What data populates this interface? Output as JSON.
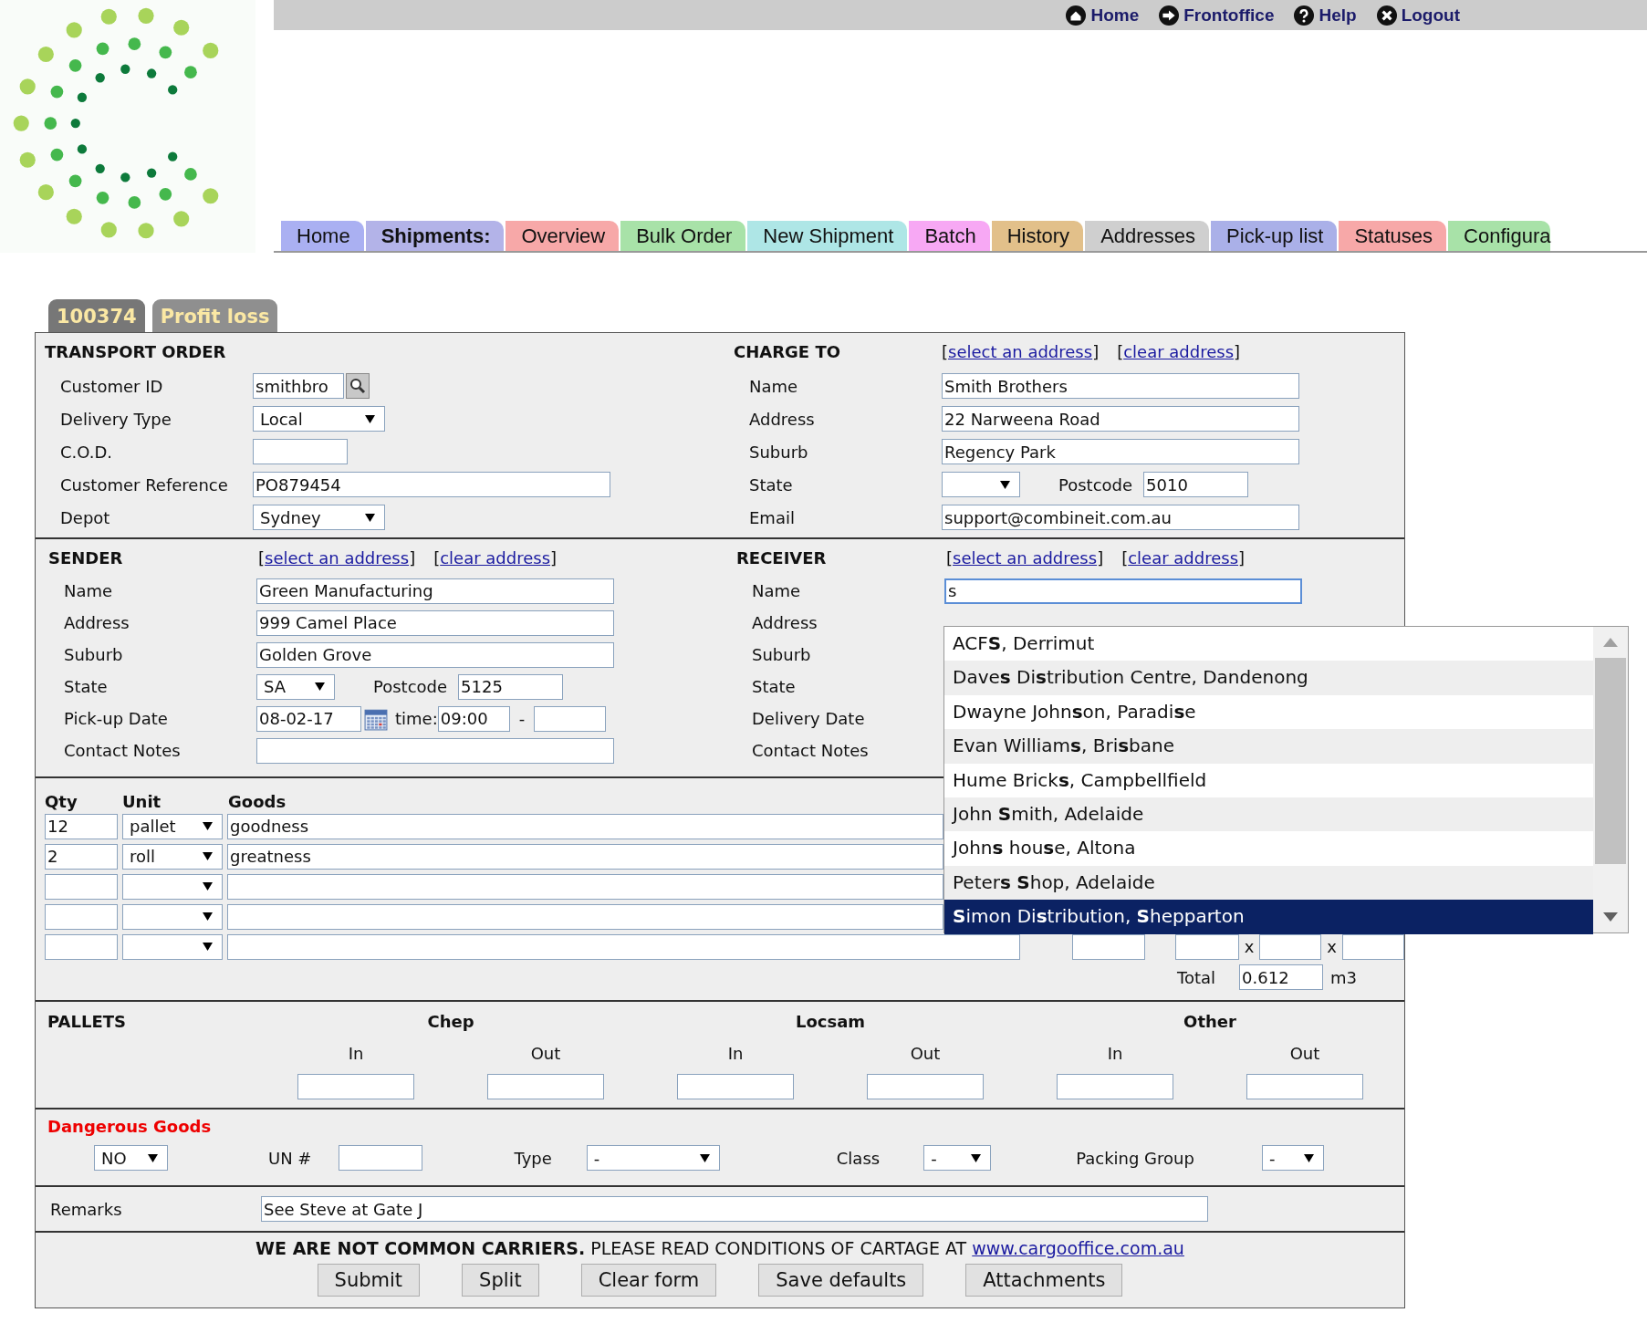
{
  "top_links": [
    {
      "label": "Home"
    },
    {
      "label": "Frontoffice"
    },
    {
      "label": "Help"
    },
    {
      "label": "Logout"
    }
  ],
  "nav_tabs": [
    {
      "label": "Home",
      "kind": "link",
      "color": "#aab0f2"
    },
    {
      "label": "Shipments:",
      "kind": "heading",
      "color": "#b3b3e8"
    },
    {
      "label": "Overview",
      "kind": "link",
      "color": "#f7a8a8"
    },
    {
      "label": "Bulk Order",
      "kind": "link",
      "color": "#a8e2a8"
    },
    {
      "label": "New Shipment",
      "kind": "link",
      "color": "#aee6e6"
    },
    {
      "label": "Batch",
      "kind": "link",
      "color": "#f7a8f4"
    },
    {
      "label": "History",
      "kind": "link",
      "color": "#e2c08a"
    },
    {
      "label": "Addresses",
      "kind": "link",
      "color": "#cfcfcf"
    },
    {
      "label": "Pick-up list",
      "kind": "link",
      "color": "#aab0e8"
    },
    {
      "label": "Statuses",
      "kind": "link",
      "color": "#f7a8a8"
    },
    {
      "label": "Configura",
      "kind": "link",
      "color": "#a8e2a8"
    }
  ],
  "form_tabs": [
    {
      "label": "100374",
      "selected": true
    },
    {
      "label": "Profit loss",
      "selected": false
    }
  ],
  "transport_order": {
    "heading": "TRANSPORT ORDER",
    "fields": [
      {
        "label": "Customer ID",
        "kind": "lookup",
        "value": "smithbro"
      },
      {
        "label": "Delivery Type",
        "kind": "select",
        "value": "Local"
      },
      {
        "label": "C.O.D.",
        "kind": "short"
      },
      {
        "label": "Customer Reference",
        "kind": "long",
        "value": "PO879454"
      },
      {
        "label": "Depot",
        "kind": "select",
        "value": "Sydney"
      }
    ]
  },
  "charge_to": {
    "heading": "CHARGE TO",
    "links": [
      {
        "before": "[",
        "label": "select an address",
        "after": "]"
      },
      {
        "before": "[",
        "label": "clear address",
        "after": "]"
      }
    ],
    "fields": [
      {
        "label": "Name",
        "kind": "long",
        "value": "Smith Brothers"
      },
      {
        "label": "Address",
        "kind": "long",
        "value": "22 Narweena Road"
      },
      {
        "label": "Suburb",
        "kind": "long",
        "value": "Regency Park"
      },
      {
        "label": "State",
        "kind": "state",
        "postcode_label": "Postcode",
        "postcode": "5010"
      },
      {
        "label": "Email",
        "kind": "long",
        "value": "support@combineit.com.au"
      }
    ]
  },
  "sender": {
    "heading": "SENDER",
    "links": [
      {
        "before": "[",
        "label": "select an address",
        "after": "]"
      },
      {
        "before": "[",
        "label": "clear address",
        "after": "]"
      }
    ],
    "fields": [
      {
        "label": "Name",
        "kind": "long",
        "value": "Green Manufacturing"
      },
      {
        "label": "Address",
        "kind": "long",
        "value": "999 Camel Place"
      },
      {
        "label": "Suburb",
        "kind": "long",
        "value": "Golden Grove"
      },
      {
        "label": "State",
        "kind": "state",
        "value": "SA",
        "postcode_label": "Postcode",
        "postcode": "5125"
      },
      {
        "label": "Pick-up Date",
        "kind": "date_time",
        "value": "08-02-17",
        "time_label": "time:",
        "time": "09:00",
        "dash": "-"
      },
      {
        "label": "Contact Notes",
        "kind": "long"
      }
    ]
  },
  "receiver": {
    "heading": "RECEIVER",
    "links": [
      {
        "before": "[",
        "label": "select an address",
        "after": "]"
      },
      {
        "before": "[",
        "label": "clear address",
        "after": "]"
      }
    ],
    "fields": [
      {
        "label": "Name",
        "kind": "long",
        "value": "s",
        "focused": true
      },
      {
        "label": "Address",
        "kind": "covered"
      },
      {
        "label": "Suburb",
        "kind": "covered"
      },
      {
        "label": "State",
        "kind": "covered"
      },
      {
        "label": "Delivery Date",
        "kind": "covered"
      },
      {
        "label": "Contact Notes",
        "kind": "covered"
      }
    ]
  },
  "goods": {
    "headers": [
      "Qty",
      "Unit",
      "Goods"
    ],
    "rows": [
      {
        "qty": "12",
        "unit": "pallet",
        "goods": "goodness"
      },
      {
        "qty": "2",
        "unit": "roll",
        "goods": "greatness"
      },
      {},
      {},
      {
        "dimension_separators": [
          "x",
          "x"
        ]
      }
    ],
    "total": {
      "label": "Total",
      "value": "0.612",
      "unit": "m3"
    }
  },
  "pallets": {
    "heading": "PALLETS",
    "groups": [
      {
        "name": "Chep",
        "columns": [
          "In",
          "Out"
        ]
      },
      {
        "name": "Locsam",
        "columns": [
          "In",
          "Out"
        ]
      },
      {
        "name": "Other",
        "columns": [
          "In",
          "Out"
        ]
      }
    ]
  },
  "dangerous_goods": {
    "heading": "Dangerous Goods",
    "value": "NO",
    "un_label": "UN #",
    "type_label": "Type",
    "type_value": "-",
    "class_label": "Class",
    "class_value": "-",
    "packing_label": "Packing Group",
    "packing_value": "-"
  },
  "remarks": {
    "label": "Remarks",
    "value": "See Steve at Gate J"
  },
  "footer": {
    "notice": "**WE ARE NOT COMMON CARRIERS.** PLEASE READ CONDITIONS OF CARTAGE AT",
    "link": "www.cargooffice.com.au",
    "buttons": [
      "Submit",
      "Split",
      "Clear form",
      "Save defaults",
      "Attachments"
    ]
  },
  "autocomplete": {
    "items": [
      {
        "label": "ACF**S**, Derrimut",
        "selected": false
      },
      {
        "label": "Dave**s** Di**s**tribution Centre, Dandenong",
        "selected": false
      },
      {
        "label": "Dwayne John**s**on, Paradi**s**e",
        "selected": false
      },
      {
        "label": "Evan William**s**, Bri**s**bane",
        "selected": false
      },
      {
        "label": "Hume Brick**s**, Campbellfield",
        "selected": false
      },
      {
        "label": "John **S**mith, Adelaide",
        "selected": false
      },
      {
        "label": "John**s** hou**s**e, Altona",
        "selected": false
      },
      {
        "label": "Peter**s** **S**hop, Adelaide",
        "selected": false
      },
      {
        "label": "**S**imon Di**s**tribution, **S**hepparton",
        "selected": true
      }
    ]
  }
}
